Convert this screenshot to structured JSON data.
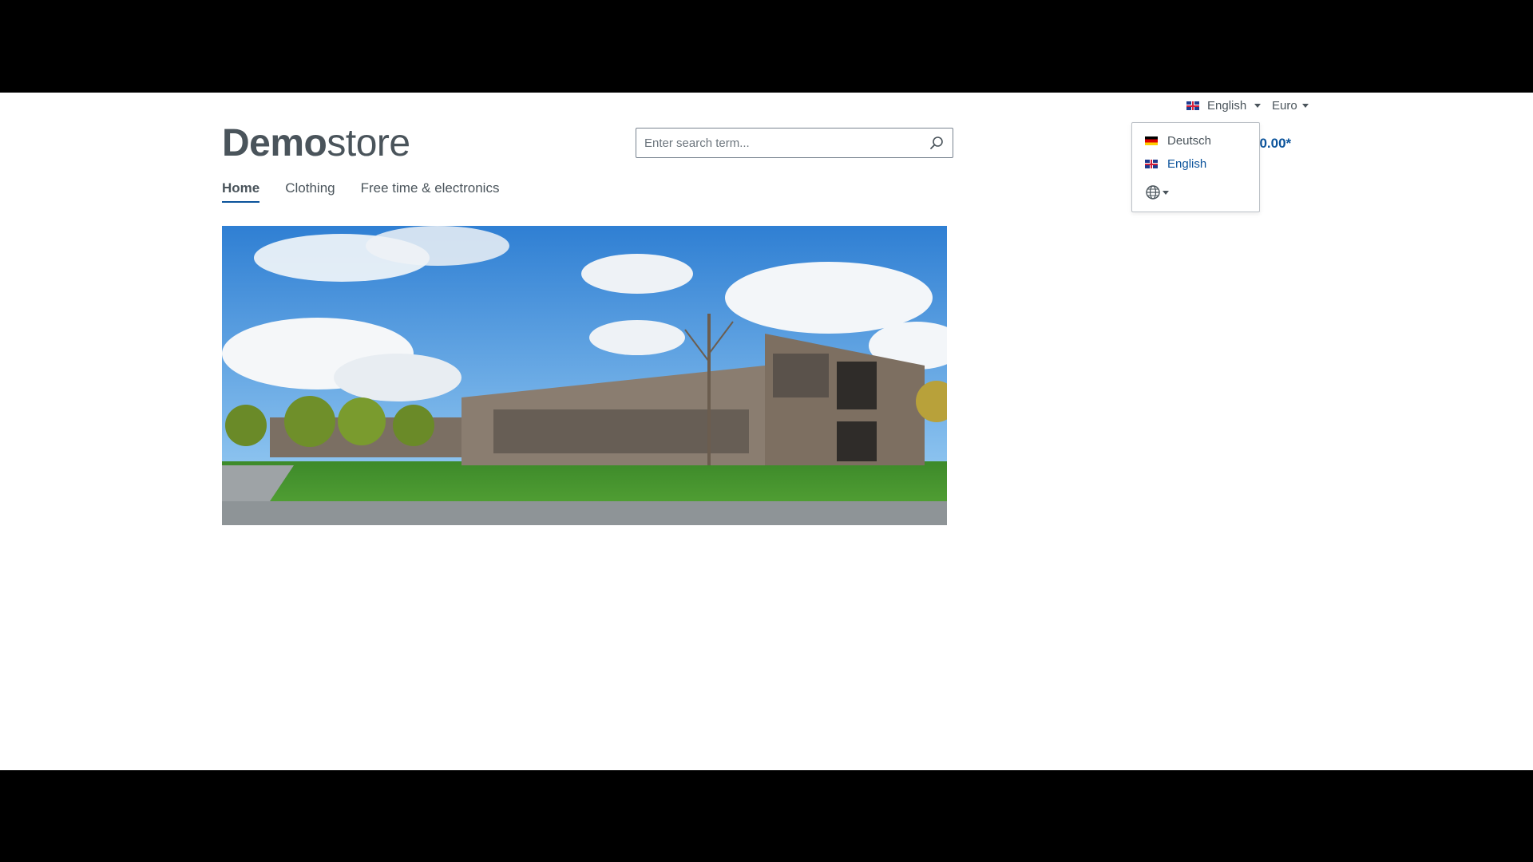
{
  "header": {
    "language_selected": "English",
    "currency_selected": "Euro",
    "logo": {
      "bold": "Demo",
      "light": "store"
    },
    "search_placeholder": "Enter search term...",
    "cart_total": "€0.00*"
  },
  "nav": {
    "items": [
      {
        "label": "Home",
        "active": true
      },
      {
        "label": "Clothing",
        "active": false
      },
      {
        "label": "Free time & electronics",
        "active": false
      }
    ]
  },
  "language_menu": {
    "options": [
      {
        "label": "Deutsch",
        "flag": "flag-de-icon"
      },
      {
        "label": "English",
        "flag": "flag-gb-icon",
        "selected": true
      }
    ],
    "extra_icon": "globe-icon"
  },
  "colors": {
    "accent": "#0b539b",
    "text": "#4a545b"
  }
}
